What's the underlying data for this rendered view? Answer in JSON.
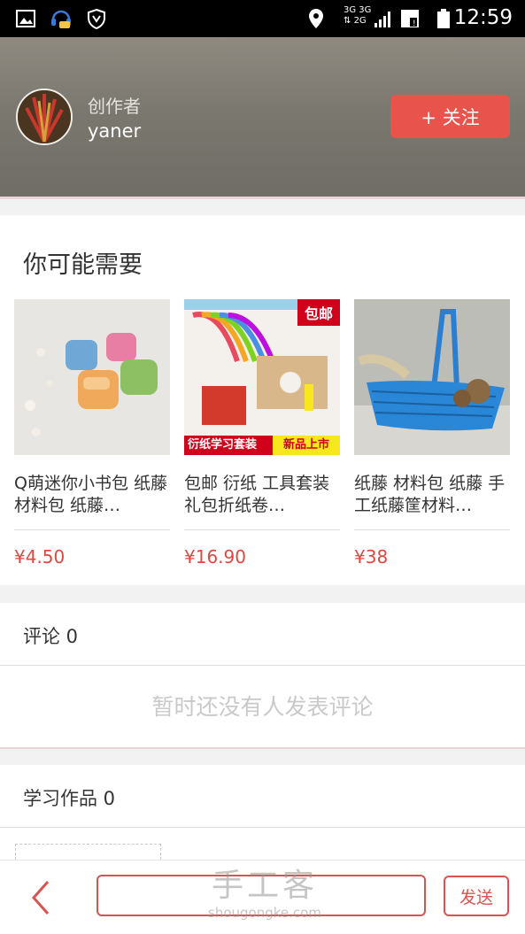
{
  "status_bar": {
    "time": "12:59",
    "network_top": "3G 3G",
    "network_bottom": "2G",
    "icons": [
      "gallery-icon",
      "chat-headset-icon",
      "shield-icon",
      "location-icon",
      "signal-icon",
      "sim-icon",
      "battery-icon"
    ]
  },
  "creator": {
    "label": "创作者",
    "name": "yaner",
    "follow_label": "+ 关注"
  },
  "recommend": {
    "title": "你可能需要",
    "products": [
      {
        "name": "Q萌迷你小书包 纸藤 材料包 纸藤…",
        "price": "¥4.50"
      },
      {
        "name": "包邮 衍纸 工具套装 礼包折纸卷…",
        "price": "¥16.90",
        "badge": "包邮",
        "banner_left": "衍纸学习套装",
        "banner_right": "新品上市"
      },
      {
        "name": "纸藤 材料包 纸藤 手工纸藤筐材料…",
        "price": "¥38"
      }
    ]
  },
  "comments": {
    "title": "评论 0",
    "empty_text": "暂时还没有人发表评论"
  },
  "works": {
    "title": "学习作品 0"
  },
  "bottom_bar": {
    "input_value": "",
    "send_label": "发送"
  },
  "watermark": {
    "main": "手工客",
    "sub": "shougongke.com"
  },
  "colors": {
    "accent": "#e8534c",
    "price": "#e0473f",
    "header": "#7b786f"
  }
}
